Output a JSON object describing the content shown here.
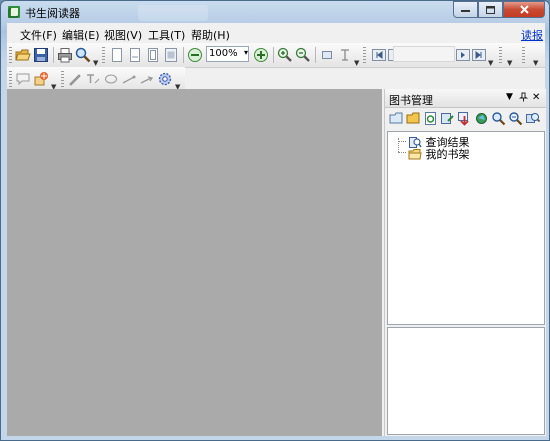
{
  "window": {
    "title": "书生阅读器"
  },
  "menu": {
    "items": [
      {
        "label": "文件(F)"
      },
      {
        "label": "编辑(E)"
      },
      {
        "label": "视图(V)"
      },
      {
        "label": "工具(T)"
      },
      {
        "label": "帮助(H)"
      }
    ],
    "right_link": "读报"
  },
  "toolbar": {
    "zoom_value": "100%"
  },
  "panel": {
    "title": "图书管理",
    "tree": [
      {
        "label": "查询结果",
        "icon": "search-results-icon"
      },
      {
        "label": "我的书架",
        "icon": "folder-icon"
      }
    ]
  },
  "colors": {
    "titlebar": "#b7cde6",
    "document_bg": "#aaaaaa",
    "link": "#0033cc",
    "close_button": "#c43b22"
  }
}
